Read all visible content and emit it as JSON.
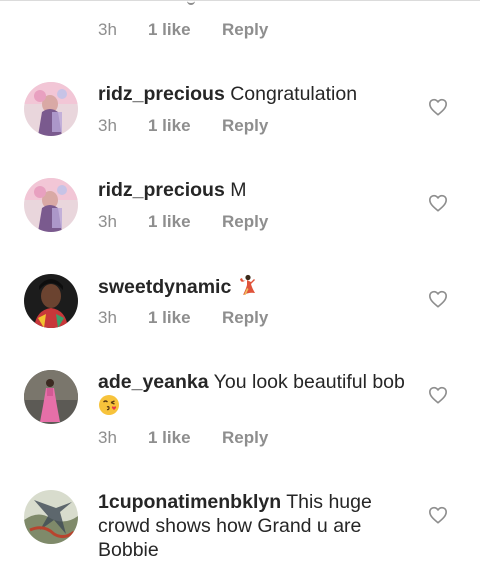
{
  "previous_comment": {
    "time": "3h",
    "likes": "1 like",
    "reply": "Reply"
  },
  "comments": [
    {
      "username": "ridz_precious",
      "text": "Congratulation",
      "time": "3h",
      "likes": "1 like",
      "reply": "Reply",
      "emoji": ""
    },
    {
      "username": "ridz_precious",
      "text": "M",
      "time": "3h",
      "likes": "1 like",
      "reply": "Reply",
      "emoji": ""
    },
    {
      "username": "sweetdynamic",
      "text": "",
      "time": "3h",
      "likes": "1 like",
      "reply": "Reply",
      "emoji": "dancer"
    },
    {
      "username": "ade_yeanka",
      "text": "You look beautiful bob",
      "time": "3h",
      "likes": "1 like",
      "reply": "Reply",
      "emoji": "kissing-face"
    },
    {
      "username": "1cuponatimenbklyn",
      "text": "This huge crowd shows how Grand u are Bobbie",
      "emoji": ""
    }
  ],
  "icons": {
    "like": "heart-outline-icon"
  },
  "colors": {
    "text": "#262626",
    "secondary": "#8e8e8e",
    "background": "#ffffff"
  }
}
